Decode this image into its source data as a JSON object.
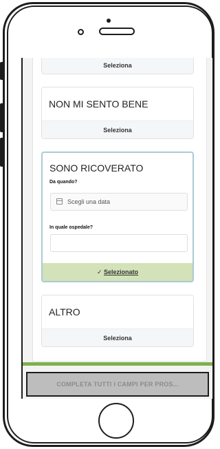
{
  "cards": [
    {
      "title": "",
      "footer": "Seleziona"
    },
    {
      "title": "NON MI SENTO BENE",
      "footer": "Seleziona"
    },
    {
      "title": "SONO RICOVERATO",
      "date_label": "Da quando?",
      "date_placeholder": "Scegli una data",
      "hospital_label": "In quale ospedale?",
      "hospital_value": "",
      "selected_label": "Selezionato"
    },
    {
      "title": "ALTRO",
      "footer": "Seleziona"
    }
  ],
  "cta": {
    "label": "COMPLETA TUTTI I CAMPI PER PROS..."
  },
  "colors": {
    "selected_border": "#a9cbd3",
    "selected_bg": "#d3e2b8",
    "accent_green": "#7fb04a",
    "cta_bg": "#bdbdbd"
  },
  "icons": {
    "date": "calendar-icon",
    "selected": "checkmark-icon"
  }
}
